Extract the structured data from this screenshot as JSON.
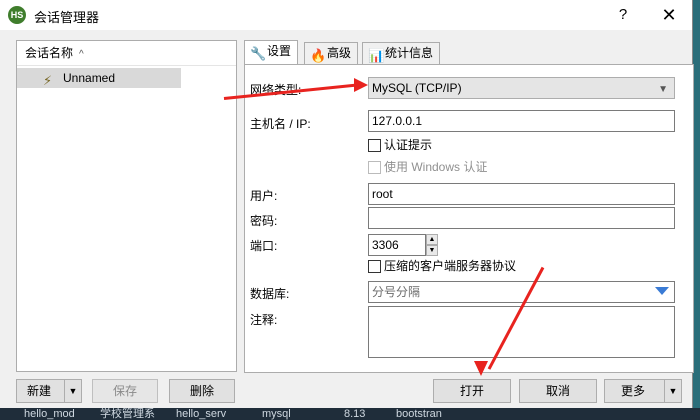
{
  "window": {
    "title": "会话管理器",
    "help_glyph": "?",
    "close_glyph": "✕",
    "icon_text": "HS"
  },
  "sessions": {
    "column_header": "会话名称",
    "items": [
      {
        "label": "Unnamed"
      }
    ]
  },
  "tabs": [
    {
      "label": "设置",
      "icon": "wrench-icon"
    },
    {
      "label": "高级",
      "icon": "flame-icon"
    },
    {
      "label": "统计信息",
      "icon": "bar-chart-icon"
    }
  ],
  "form": {
    "network_type_label": "网络类型:",
    "network_type_value": "MySQL (TCP/IP)",
    "host_label": "主机名 / IP:",
    "host_value": "127.0.0.1",
    "auth_prompt_label": "认证提示",
    "windows_auth_label": "使用 Windows 认证",
    "user_label": "用户:",
    "user_value": "root",
    "password_label": "密码:",
    "password_value": "",
    "port_label": "端口:",
    "port_value": "3306",
    "compress_label": "压缩的客户端服务器协议",
    "database_label": "数据库:",
    "database_placeholder": "分号分隔",
    "comment_label": "注释:"
  },
  "buttons": {
    "new": "新建",
    "save": "保存",
    "delete": "删除",
    "open": "打开",
    "cancel": "取消",
    "more": "更多"
  },
  "taskbar": [
    "hello_mod",
    "学校管理系",
    "hello_serv",
    "mysql",
    "8.13",
    "bootstran"
  ],
  "colors": {
    "annotation_arrow": "#e8231f",
    "accent": "#3a7bd5"
  }
}
